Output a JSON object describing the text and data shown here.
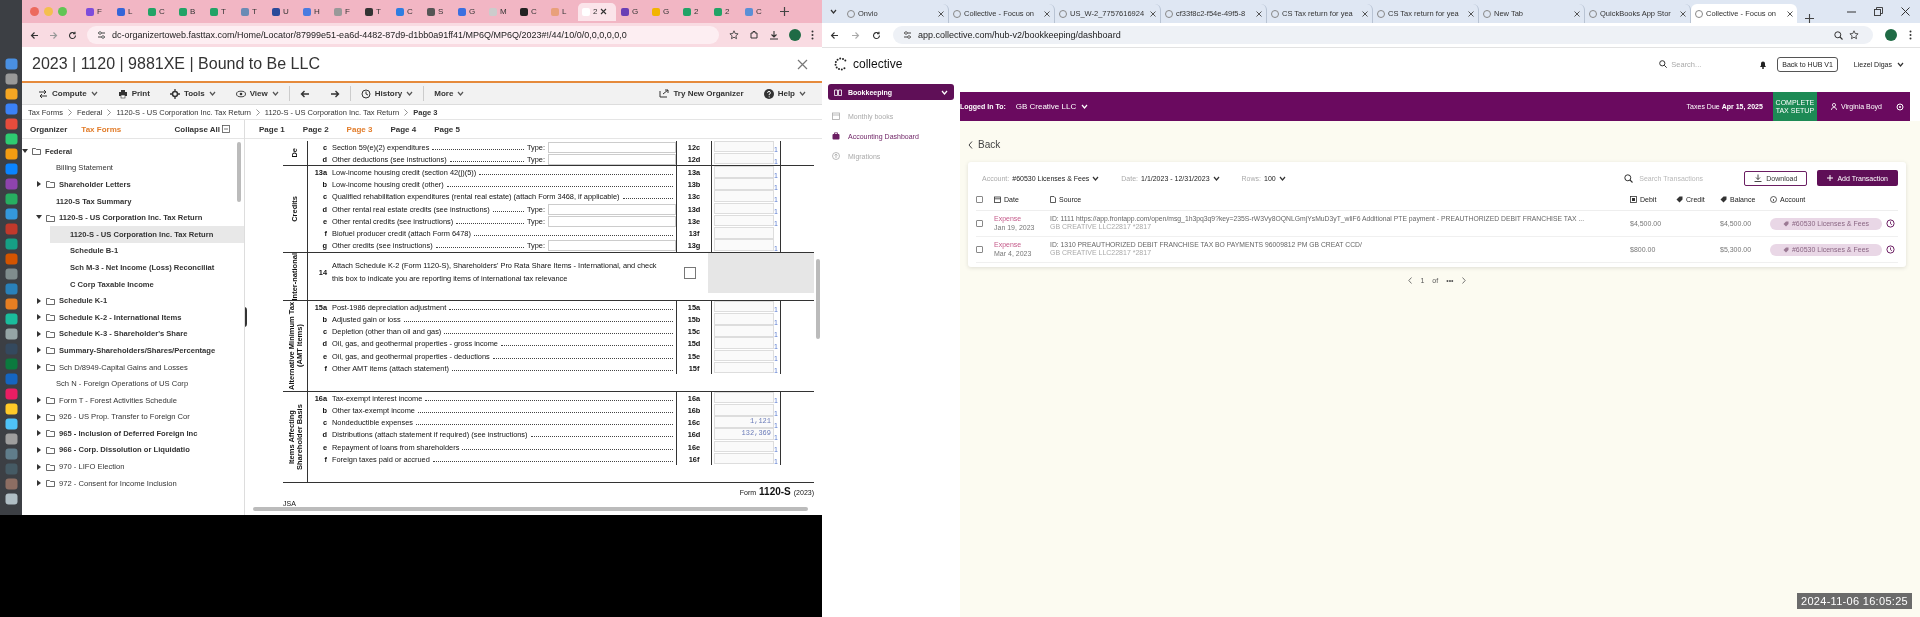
{
  "left_window": {
    "tabs": [
      {
        "label": "F",
        "selected": false
      },
      {
        "label": "L",
        "selected": false
      },
      {
        "label": "C",
        "selected": false
      },
      {
        "label": "B",
        "selected": false
      },
      {
        "label": "T",
        "selected": false
      },
      {
        "label": "T",
        "selected": false
      },
      {
        "label": "U",
        "selected": false
      },
      {
        "label": "H",
        "selected": false
      },
      {
        "label": "F",
        "selected": false
      },
      {
        "label": "T",
        "selected": false
      },
      {
        "label": "C",
        "selected": false
      },
      {
        "label": "S",
        "selected": false
      },
      {
        "label": "G",
        "selected": false
      },
      {
        "label": "M",
        "selected": false
      },
      {
        "label": "C",
        "selected": false
      },
      {
        "label": "L",
        "selected": false
      },
      {
        "label": "2",
        "selected": true
      },
      {
        "label": "G",
        "selected": false
      },
      {
        "label": "G",
        "selected": false
      },
      {
        "label": "2",
        "selected": false
      },
      {
        "label": "2",
        "selected": false
      },
      {
        "label": "C",
        "selected": false
      }
    ],
    "address": "dc-organizertoweb.fasttax.com/Home/Locator/87999e51-ea6d-4482-87d9-d1bb0a91ff41/MP6Q/MP6Q/2023#!/44/10/0/0,0,0,0,0,0",
    "title": "2023 | 1120 | 9881XE | Bound to Be LLC",
    "toolbar": [
      {
        "label": "Compute",
        "kind": "menu"
      },
      {
        "label": "Print",
        "kind": "button"
      },
      {
        "label": "Tools",
        "kind": "menu"
      },
      {
        "label": "View",
        "kind": "menu"
      },
      {
        "kind": "back"
      },
      {
        "kind": "forward"
      },
      {
        "label": "History",
        "kind": "menu"
      },
      {
        "label": "More",
        "kind": "menu"
      }
    ],
    "toolbar_right": [
      {
        "label": "Try New Organizer",
        "kind": "button"
      },
      {
        "label": "Help",
        "kind": "menu"
      }
    ],
    "breadcrumb": [
      "Tax Forms",
      "Federal",
      "1120-S - US Corporation Inc. Tax Return",
      "1120-S - US Corporation Inc. Tax Return",
      "Page 3"
    ],
    "sidebar_tabs": [
      {
        "label": "Organizer",
        "selected": false
      },
      {
        "label": "Tax Forms",
        "selected": true
      }
    ],
    "collapse_all": "Collapse All",
    "page_tabs": [
      {
        "label": "Page 1",
        "selected": false
      },
      {
        "label": "Page 2",
        "selected": false
      },
      {
        "label": "Page 3",
        "selected": true
      },
      {
        "label": "Page 4",
        "selected": false
      },
      {
        "label": "Page 5",
        "selected": false
      }
    ],
    "tree": [
      {
        "label": "Federal",
        "kind": "folder",
        "expanded": true,
        "bold": true,
        "selected": false,
        "children": [
          {
            "label": "Billing Statement",
            "kind": "item",
            "bold": false,
            "selected": false
          },
          {
            "label": "Shareholder Letters",
            "kind": "folder",
            "expanded": false,
            "bold": true,
            "selected": false
          },
          {
            "label": "1120-S Tax Summary",
            "kind": "item",
            "bold": true,
            "selected": false
          },
          {
            "label": "1120-S - US Corporation Inc. Tax Return",
            "kind": "folder",
            "expanded": true,
            "bold": true,
            "selected": false,
            "children": [
              {
                "label": "1120-S - US Corporation Inc. Tax Return",
                "kind": "item",
                "bold": true,
                "selected": true
              },
              {
                "label": "Schedule B-1",
                "kind": "item",
                "bold": true,
                "selected": false
              },
              {
                "label": "Sch M-3 - Net Income (Loss) Reconciliat",
                "kind": "item",
                "bold": true,
                "selected": false
              },
              {
                "label": "C Corp Taxable Income",
                "kind": "item",
                "bold": true,
                "selected": false
              }
            ]
          },
          {
            "label": "Schedule K-1",
            "kind": "folder",
            "expanded": false,
            "bold": true,
            "selected": false
          },
          {
            "label": "Schedule K-2 - International Items",
            "kind": "folder",
            "expanded": false,
            "bold": true,
            "selected": false
          },
          {
            "label": "Schedule K-3 - Shareholder's Share",
            "kind": "folder",
            "expanded": false,
            "bold": true,
            "selected": false
          },
          {
            "label": "Summary-Shareholders/Shares/Percentage",
            "kind": "folder",
            "expanded": false,
            "bold": true,
            "selected": false
          },
          {
            "label": "Sch D/8949-Capital Gains and Losses",
            "kind": "folder",
            "expanded": false,
            "bold": false,
            "selected": false
          },
          {
            "label": "Sch N - Foreign Operations of US Corp",
            "kind": "item",
            "bold": false,
            "selected": false
          },
          {
            "label": "Form T - Forest Activities Schedule",
            "kind": "folder",
            "expanded": false,
            "bold": false,
            "selected": false
          },
          {
            "label": "926 - US Prop. Transfer to Foreign Cor",
            "kind": "folder",
            "expanded": false,
            "bold": false,
            "selected": false
          },
          {
            "label": "965 - Inclusion of Deferred Foreign Inc",
            "kind": "folder",
            "expanded": false,
            "bold": true,
            "selected": false
          },
          {
            "label": "966 - Corp. Dissolution or Liquidatio",
            "kind": "folder",
            "expanded": false,
            "bold": true,
            "selected": false
          },
          {
            "label": "970 - LIFO Election",
            "kind": "folder",
            "expanded": false,
            "bold": false,
            "selected": false
          },
          {
            "label": "972 - Consent for Income Inclusion",
            "kind": "folder",
            "expanded": false,
            "bold": false,
            "selected": false
          }
        ]
      }
    ],
    "form": {
      "sections": [
        {
          "label": "De",
          "rows": [
            {
              "kind": "line",
              "num": "c",
              "text": "Section 59(e)(2) expenditures",
              "type_label": "Type:",
              "code": "12c",
              "flag": "1"
            },
            {
              "kind": "line",
              "num": "d",
              "text": "Other deductions (see instructions)",
              "type_label": "Type:",
              "code": "12d",
              "flag": "1"
            }
          ]
        },
        {
          "label": "Credits",
          "rows": [
            {
              "kind": "line",
              "num": "13a",
              "text": "Low-income housing credit (section 42(j)(5))",
              "code": "13a",
              "flag": "1"
            },
            {
              "kind": "line",
              "num": "b",
              "text": "Low-income housing credit (other)",
              "code": "13b",
              "flag": "1"
            },
            {
              "kind": "line",
              "num": "c",
              "text": "Qualified rehabilitation expenditures (rental real estate) (attach Form 3468, if applicable)",
              "code": "13c",
              "flag": "1"
            },
            {
              "kind": "line",
              "num": "d",
              "text": "Other rental real estate credits (see instructions)",
              "type_label": "Type:",
              "code": "13d",
              "flag": "1"
            },
            {
              "kind": "line",
              "num": "e",
              "text": "Other rental credits (see instructions)",
              "type_label": "Type:",
              "code": "13e",
              "flag": "1"
            },
            {
              "kind": "line",
              "num": "f",
              "text": "Biofuel producer credit (attach Form 6478)",
              "code": "13f"
            },
            {
              "kind": "line",
              "num": "g",
              "text": "Other credits (see instructions)",
              "type_label": "Type:",
              "code": "13g",
              "flag": "1"
            }
          ]
        },
        {
          "label": "Inter-national",
          "rows": [
            {
              "kind": "checkbox",
              "num": "14",
              "text": "Attach Schedule K-2 (Form 1120-S), Shareholders' Pro Rata Share Items - International, and check this box to indicate you are reporting items of international tax relevance",
              "checked": false
            }
          ]
        },
        {
          "label": "Alternative Minimum Tax (AMT Items)",
          "rows": [
            {
              "kind": "line",
              "num": "15a",
              "text": "Post-1986 depreciation adjustment",
              "code": "15a",
              "flag": "1"
            },
            {
              "kind": "line",
              "num": "b",
              "text": "Adjusted gain or loss",
              "code": "15b",
              "flag": "1"
            },
            {
              "kind": "line",
              "num": "c",
              "text": "Depletion (other than oil and gas)",
              "code": "15c",
              "flag": "1"
            },
            {
              "kind": "line",
              "num": "d",
              "text": "Oil, gas, and geothermal properties - gross income",
              "code": "15d",
              "flag": "1"
            },
            {
              "kind": "line",
              "num": "e",
              "text": "Oil, gas, and geothermal properties - deductions",
              "code": "15e",
              "flag": "1"
            },
            {
              "kind": "line",
              "num": "f",
              "text": "Other AMT items (attach statement)",
              "code": "15f",
              "flag": "1"
            }
          ]
        },
        {
          "label": "Items Affecting Shareholder Basis",
          "rows": [
            {
              "kind": "line",
              "num": "16a",
              "text": "Tax-exempt interest income",
              "code": "16a",
              "flag": "1"
            },
            {
              "kind": "line",
              "num": "b",
              "text": "Other tax-exempt income",
              "code": "16b",
              "flag": "1"
            },
            {
              "kind": "line",
              "num": "c",
              "text": "Nondeductible expenses",
              "code": "16c",
              "value": "1,121",
              "flag": "1"
            },
            {
              "kind": "line",
              "num": "d",
              "text": "Distributions (attach statement if required) (see instructions)",
              "code": "16d",
              "value": "132,369",
              "flag": "1"
            },
            {
              "kind": "line",
              "num": "e",
              "text": "Repayment of loans from shareholders",
              "code": "16e",
              "flag": "1"
            },
            {
              "kind": "line",
              "num": "f",
              "text": "Foreign taxes paid or accrued",
              "code": "16f",
              "flag": "1"
            }
          ]
        }
      ],
      "footer": {
        "form_word": "Form",
        "form_number": "1120-S",
        "year": "(2023)"
      },
      "jsa": "JSA"
    }
  },
  "right_window": {
    "tabs": [
      {
        "label": "Onvio",
        "selected": false
      },
      {
        "label": "Collective - Focus on",
        "selected": false
      },
      {
        "label": "US_W-2_7757616924",
        "selected": false
      },
      {
        "label": "cf33f8c2-f54e-49f5-8",
        "selected": false
      },
      {
        "label": "CS Tax return for yea",
        "selected": false
      },
      {
        "label": "CS Tax return for yea",
        "selected": false
      },
      {
        "label": "New Tab",
        "selected": false
      },
      {
        "label": "QuickBooks App Stor",
        "selected": false
      },
      {
        "label": "Collective - Focus on",
        "selected": true
      }
    ],
    "address": "app.collective.com/hub-v2/bookkeeping/dashboard",
    "logo": "collective",
    "search_placeholder": "Search...",
    "back_to_hub": "Back to HUB V1",
    "user": "Liezel Digas",
    "sidebar": {
      "section": "Bookkeeping",
      "items": [
        {
          "label": "Monthly books",
          "selected": false
        },
        {
          "label": "Accounting Dashboard",
          "selected": true
        },
        {
          "label": "Migrations",
          "selected": false
        }
      ]
    },
    "banner": {
      "logged_in_label": "Logged In To:",
      "company": "GB Creative LLC",
      "taxes_due": "Taxes Due **Apr 15, 2025**",
      "setup_button": "COMPLETE TAX SETUP",
      "client": "Virginia Boyd"
    },
    "back": "Back",
    "filters": [
      {
        "label": "Account:",
        "value": "#60530 Licenses & Fees"
      },
      {
        "label": "Date:",
        "value": "1/1/2023 - 12/31/2023"
      },
      {
        "label": "Rows:",
        "value": "100"
      }
    ],
    "search_transactions_placeholder": "Search Transactions",
    "download": "Download",
    "add_transaction": "Add Transaction",
    "select_all_checked": false,
    "columns": [
      "Date",
      "Source",
      "Debit",
      "Credit",
      "Balance",
      "Account"
    ],
    "rows": [
      {
        "checked": false,
        "type": "Expense",
        "date": "Jan 19, 2023",
        "source": "ID: 1111 https://app.frontapp.com/open/msg_1h3pq3q9?key=235S-rW3Vy8OQNLGmjYsMuD3yT_wliF6 Additional PTE payment - PREAUTHORIZED DEBIT FRANCHISE TAX ...",
        "detail": "GB CREATIVE LLC22817 *2817",
        "debit": "$4,500.00",
        "balance": "$4,500.00",
        "account": "#60530 Licenses & Fees"
      },
      {
        "checked": false,
        "type": "Expense",
        "date": "Mar 4, 2023",
        "source": "ID: 1310 PREAUTHORIZED DEBIT FRANCHISE TAX BO PAYMENTS 96009812 PM GB CREAT CCD/",
        "detail": "GB CREATIVE LLC22817 *2817",
        "debit": "$800.00",
        "balance": "$5,300.00",
        "account": "#60530 Licenses & Fees"
      }
    ],
    "pagination": {
      "page": "1",
      "of": "of",
      "more": "•••"
    }
  },
  "timestamp": "2024-11-06 16:05:25"
}
